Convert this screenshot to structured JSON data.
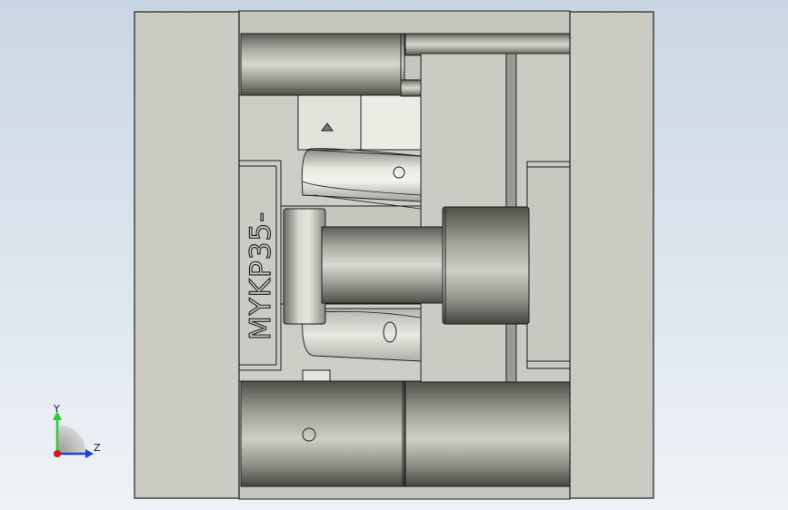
{
  "model": {
    "engraved_text": "MYKP35-"
  },
  "triad": {
    "y_label": "Y",
    "z_label": "Z",
    "colors": {
      "y": "#2ecc2e",
      "z": "#1f3fd8",
      "x": "#d11d1d"
    }
  },
  "palette": {
    "plate": "#cbcbc3",
    "plate_edge": "#1e1e1e",
    "cylinder_dark": "#55554d",
    "cylinder_light": "#e4e4dc"
  }
}
